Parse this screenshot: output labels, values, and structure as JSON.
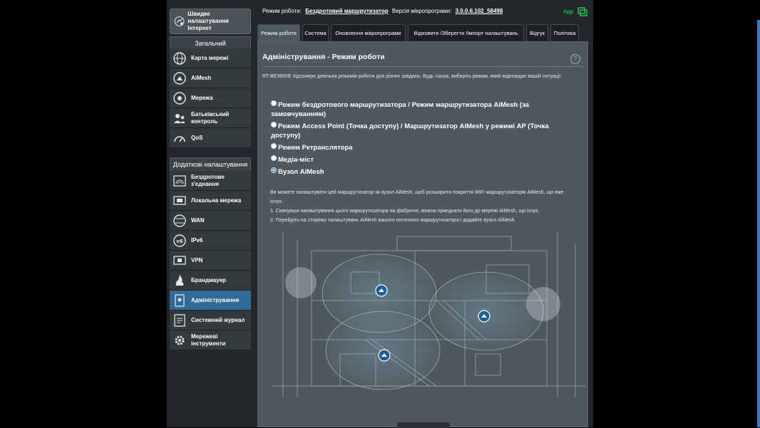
{
  "sidebar": {
    "quick": "Швидке налаштування Інтернет",
    "general_header": "Загальний",
    "general": [
      {
        "icon": "globe-icon",
        "label": "Карта мережі"
      },
      {
        "icon": "aimesh-icon",
        "label": "AiMesh"
      },
      {
        "icon": "network-icon",
        "label": "Мережа"
      },
      {
        "icon": "parental-icon",
        "label": "Батьківський контроль"
      },
      {
        "icon": "qos-gauge-icon",
        "label": "QoS"
      }
    ],
    "advanced_header": "Додаткові налаштування",
    "advanced": [
      {
        "icon": "wifi-icon",
        "label": "Бездротове з'єднання"
      },
      {
        "icon": "lan-icon",
        "label": "Локальна мережа"
      },
      {
        "icon": "wan-globe-icon",
        "label": "WAN"
      },
      {
        "icon": "ipv6-icon",
        "label": "IPv6"
      },
      {
        "icon": "vpn-icon",
        "label": "VPN"
      },
      {
        "icon": "firewall-icon",
        "label": "Брандмауер"
      },
      {
        "icon": "admin-icon",
        "label": "Адміністрування",
        "active": true
      },
      {
        "icon": "log-icon",
        "label": "Системний журнал"
      },
      {
        "icon": "tools-gear-icon",
        "label": "Мережеві інструменти"
      }
    ]
  },
  "status": {
    "mode_label": "Режим роботи:",
    "mode_value": "Бездротовий маршрутизатор",
    "fw_label": "Версія мікропрограми:",
    "fw_value": "3.0.0.6.102_58498",
    "app": "App"
  },
  "tabs": [
    {
      "label": "Режим роботи",
      "active": true
    },
    {
      "label": "Система"
    },
    {
      "label": "Оновлення мікропрограми"
    },
    {
      "label": "Відновити /Зберегти /Імпорт налаштувань"
    },
    {
      "label": "Відгук"
    },
    {
      "label": "Політика"
    }
  ],
  "panel": {
    "title": "Адміністрування - Режим роботи",
    "help": "?",
    "intro": "RT-BE3600E підтримує декілька режимів роботи для різних завдань. Будь ласка, виберіть режим, який відповідає вашій ситуації.",
    "modes": [
      {
        "label": "Режим бездротового маршрутизатора / Режим маршрутизатора AiMesh (за замовчуванням)",
        "selected": false
      },
      {
        "label": "Режим Access Point (Точка доступу) / Маршрутизатор AiMesh у режимі AP (Точка доступу)",
        "selected": false
      },
      {
        "label": "Режим Ретранслятора",
        "selected": false
      },
      {
        "label": "Медіа-міст",
        "selected": false
      },
      {
        "label": "Вузол AiMesh",
        "selected": true
      }
    ],
    "desc": [
      "Ви можете налаштувати цей маршрутизатор як вузол AiMesh, щоб розширити покриття WiFi маршрутизаторів AiMesh, що вже існує.",
      "1. Скинувши налаштування цього маршрутизатора на фабричні, можна приєднати його до мережі AiMesh, що існує.",
      "2. Перейдіть на сторінку налаштувань AiMesh вашого поточного маршрутизатора і додайте вузол AiMesh."
    ]
  },
  "colors": {
    "accent": "#2f6b96",
    "app_green": "#1fd85a",
    "panel": "#4e585e"
  }
}
